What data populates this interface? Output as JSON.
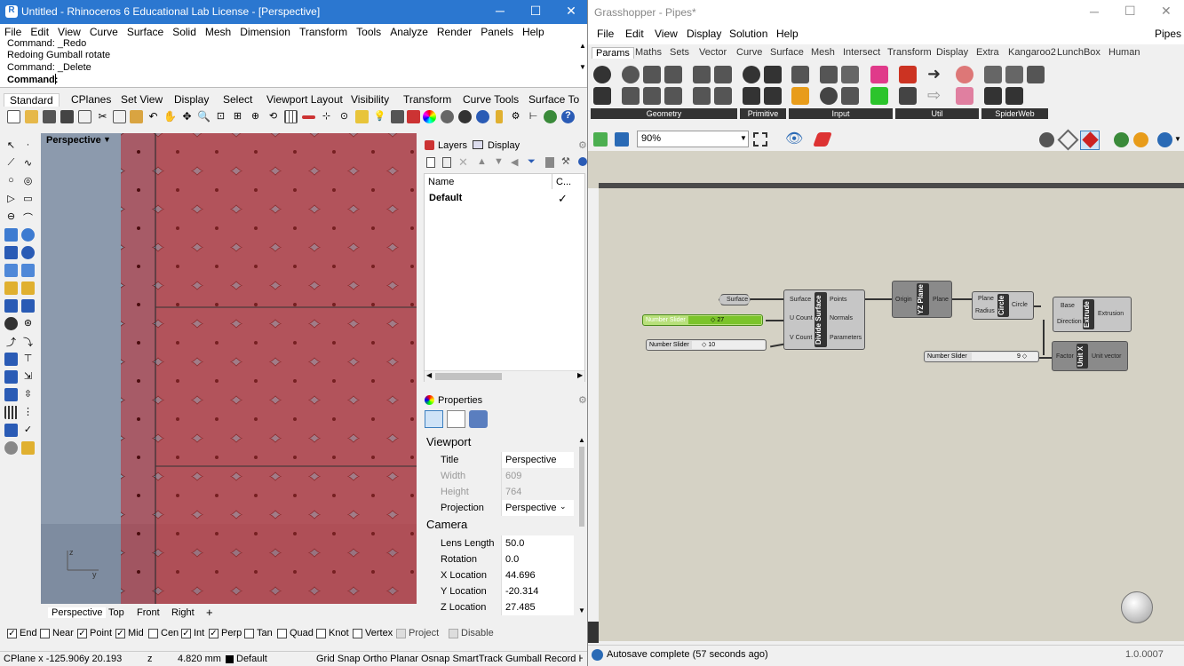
{
  "rhino": {
    "title": "Untitled - Rhinoceros 6 Educational Lab License - [Perspective]",
    "menu": [
      "File",
      "Edit",
      "View",
      "Curve",
      "Surface",
      "Solid",
      "Mesh",
      "Dimension",
      "Transform",
      "Tools",
      "Analyze",
      "Render",
      "Panels",
      "Help"
    ],
    "command_history": [
      "Command: _Redo",
      "Redoing Gumball rotate",
      "Command: _Delete"
    ],
    "command_prompt": "Command:",
    "toolbar_tabs": [
      "Standard",
      "CPlanes",
      "Set View",
      "Display",
      "Select",
      "Viewport Layout",
      "Visibility",
      "Transform",
      "Curve Tools",
      "Surface To"
    ],
    "viewport_label": "Perspective",
    "viewport_tabs": [
      "Perspective",
      "Top",
      "Front",
      "Right"
    ],
    "panels": {
      "layers_tab": "Layers",
      "display_tab": "Display",
      "col_name": "Name",
      "col_current": "C...",
      "layer_default": "Default",
      "layer_check": "✓",
      "properties_title": "Properties",
      "section_viewport": "Viewport",
      "section_camera": "Camera",
      "viewport_props": [
        {
          "key": "Title",
          "value": "Perspective",
          "grey": false
        },
        {
          "key": "Width",
          "value": "609",
          "grey": true
        },
        {
          "key": "Height",
          "value": "764",
          "grey": true
        },
        {
          "key": "Projection",
          "value": "Perspective",
          "grey": false
        }
      ],
      "camera_props": [
        {
          "key": "Lens Length",
          "value": "50.0"
        },
        {
          "key": "Rotation",
          "value": "0.0"
        },
        {
          "key": "X Location",
          "value": "44.696"
        },
        {
          "key": "Y Location",
          "value": "-20.314"
        },
        {
          "key": "Z Location",
          "value": "27.485"
        }
      ]
    },
    "osnaps": [
      {
        "label": "End",
        "checked": true
      },
      {
        "label": "Near",
        "checked": false
      },
      {
        "label": "Point",
        "checked": true
      },
      {
        "label": "Mid",
        "checked": true
      },
      {
        "label": "Cen",
        "checked": false
      },
      {
        "label": "Int",
        "checked": true
      },
      {
        "label": "Perp",
        "checked": true
      },
      {
        "label": "Tan",
        "checked": false
      },
      {
        "label": "Quad",
        "checked": false
      },
      {
        "label": "Knot",
        "checked": false
      },
      {
        "label": "Vertex",
        "checked": false
      },
      {
        "label": "Project",
        "checked": false
      },
      {
        "label": "Disable",
        "checked": false
      }
    ],
    "status": {
      "cplane": "CPlane x -125.906",
      "y": "y 20.193",
      "z": "z",
      "units": "4.820 mm",
      "layer": "Default",
      "toggles": "Grid Snap Ortho Planar Osnap SmartTrack Gumball Record History Filter"
    }
  },
  "gh": {
    "title": "Grasshopper - Pipes*",
    "menu": [
      "File",
      "Edit",
      "View",
      "Display",
      "Solution",
      "Help"
    ],
    "doc_name": "Pipes",
    "tabs": [
      "Params",
      "Maths",
      "Sets",
      "Vector",
      "Curve",
      "Surface",
      "Mesh",
      "Intersect",
      "Transform",
      "Display",
      "Extra",
      "Kangaroo2",
      "LunchBox",
      "Human"
    ],
    "groups": [
      "Geometry",
      "Primitive",
      "Input",
      "Util",
      "SpiderWeb"
    ],
    "zoom": "90%",
    "nodes": {
      "surface_param": "Surface",
      "slider1_name": "Number Slider",
      "slider1_value": "◇ 27",
      "slider2_name": "Number Slider",
      "slider2_value": "◇ 10",
      "slider3_name": "Number Slider",
      "slider3_value": "9 ◇",
      "divide_in": [
        "Surface",
        "U Count",
        "V Count"
      ],
      "divide_name": "Divide Surface",
      "divide_out": [
        "Points",
        "Normals",
        "Parameters"
      ],
      "yz_in": "Origin",
      "yz_name": "YZ Plane",
      "yz_out": "Plane",
      "circle_in": [
        "Plane",
        "Radius"
      ],
      "circle_name": "Circle",
      "circle_out": "Circle",
      "extrude_in": [
        "Base",
        "Direction"
      ],
      "extrude_name": "Extrude",
      "extrude_out": "Extrusion",
      "unitx_in": "Factor",
      "unitx_name": "Unit X",
      "unitx_out": "Unit vector"
    },
    "status": "Autosave complete (57 seconds ago)",
    "version": "1.0.0007"
  }
}
